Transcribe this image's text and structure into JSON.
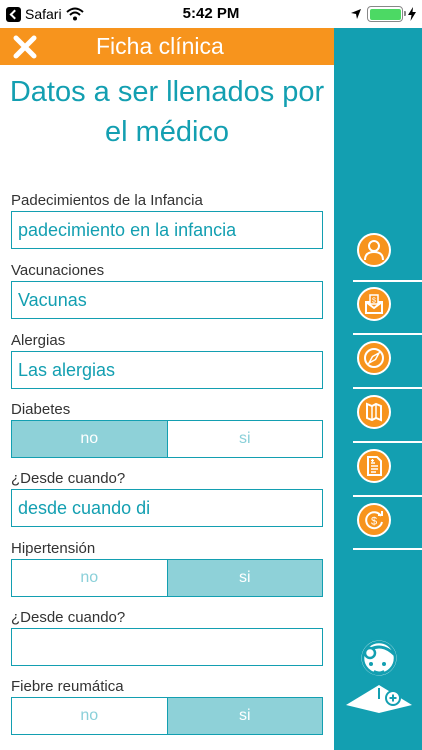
{
  "status_bar": {
    "back_app": "Safari",
    "time": "5:42 PM",
    "battery_level": 1.0
  },
  "header": {
    "title": "Ficha clínica",
    "close_icon": "close-x-icon",
    "background": "#f7941d"
  },
  "main": {
    "title": "Datos a ser llenados por el médico",
    "accent_color": "#139fb1"
  },
  "form": {
    "padecimientos": {
      "label": "Padecimientos de la Infancia",
      "value": "padecimiento en la infancia"
    },
    "vacunaciones": {
      "label": "Vacunaciones",
      "value": "Vacunas"
    },
    "alergias": {
      "label": "Alergias",
      "value": "Las alergias"
    },
    "diabetes": {
      "label": "Diabetes",
      "option_no": "no",
      "option_si": "si",
      "selected": "no"
    },
    "diabetes_desde": {
      "label": "¿Desde cuando?",
      "value": "desde cuando di"
    },
    "hipertension": {
      "label": "Hipertensión",
      "option_no": "no",
      "option_si": "si",
      "selected": "si"
    },
    "hipertension_desde": {
      "label": "¿Desde cuando?",
      "value": ""
    },
    "fiebre": {
      "label": "Fiebre reumática",
      "option_no": "no",
      "option_si": "si",
      "selected": "si"
    }
  },
  "sidebar": {
    "background": "#139fb1",
    "items": [
      {
        "icon": "user-icon"
      },
      {
        "icon": "payment-envelope-icon"
      },
      {
        "icon": "compass-icon"
      },
      {
        "icon": "map-icon"
      },
      {
        "icon": "prescription-document-icon"
      },
      {
        "icon": "refund-money-icon"
      }
    ],
    "logo_icon": "doctor-icon"
  }
}
